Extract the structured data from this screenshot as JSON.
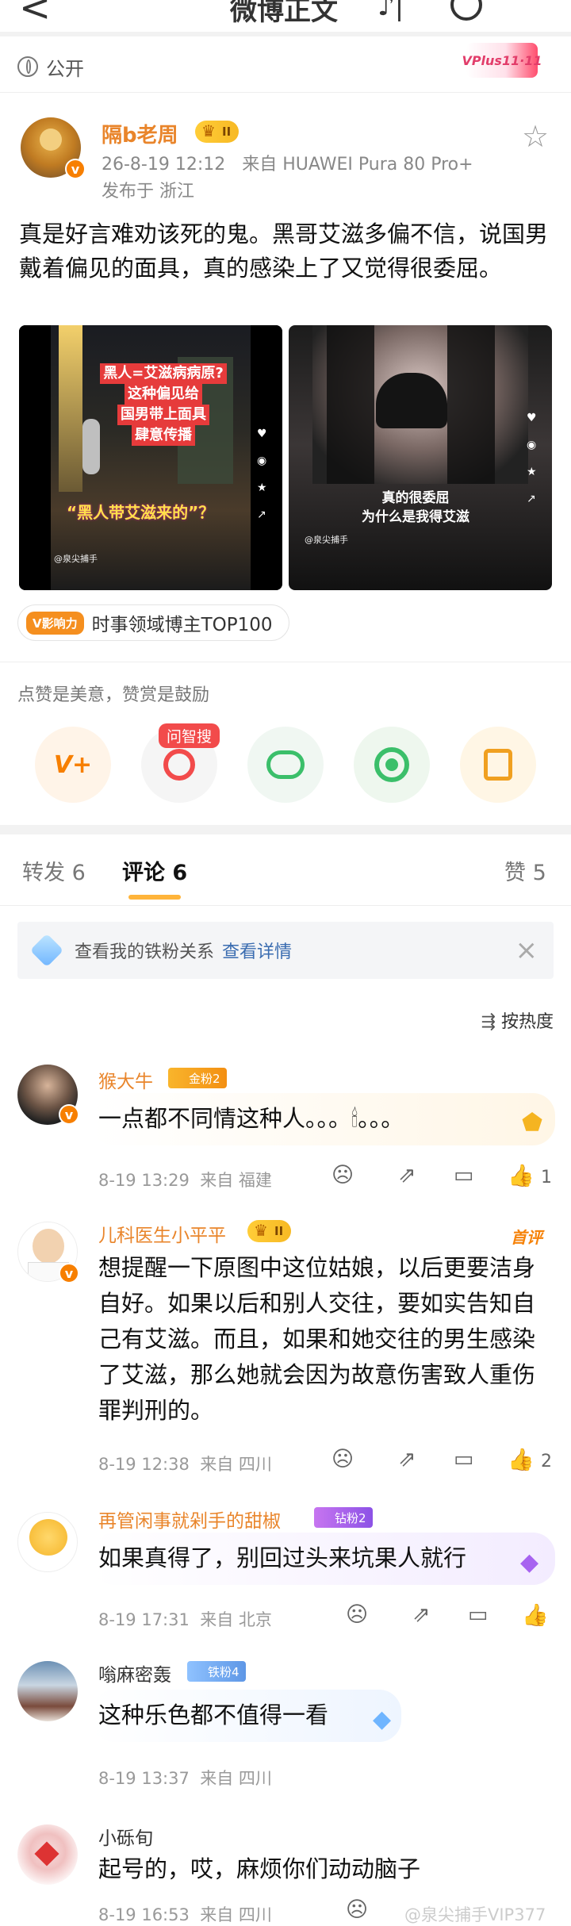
{
  "topbar": {
    "title": "微博正文",
    "back_glyph": "<",
    "mid_glyph": "♪|"
  },
  "visibility": {
    "label": "公开",
    "vplus": "VPlus11·11"
  },
  "post": {
    "author": "隔b老周",
    "level": "II",
    "time": "26-8-19 12:12",
    "source": "来自 HUAWEI Pura 80 Pro+",
    "location": "发布于 浙江",
    "text": "真是好言难劝该死的鬼。黑哥艾滋多偏不信，说国男戴着偏见的面具，真的感染上了又觉得很委屈。",
    "image1": {
      "overlay": [
        "黑人=艾滋病病原?",
        "这种偏见给",
        "国男带上面具",
        "肆意传播"
      ],
      "caption": "“黑人带艾滋来的”？",
      "user": "@泉尖捕手"
    },
    "image2": {
      "overlay": [
        "真的很委屈",
        "为什么是我得艾滋"
      ],
      "user": "@泉尖捕手"
    },
    "tag": {
      "badge": "V影响力",
      "text": "时事领域博主TOP100"
    }
  },
  "reward": {
    "tip": "点赞是美意，赞赏是鼓励",
    "qz_label": "问智搜",
    "actions": [
      {
        "icon": "v-plus-icon",
        "glyph": "V+",
        "color": "#f77f00",
        "bg": "#fff4e8"
      },
      {
        "icon": "zhisou-search-icon",
        "glyph": "◯",
        "color": "#f24b4b",
        "bg": "#f5f5f5"
      },
      {
        "icon": "wechat-icon",
        "glyph": "💬",
        "color": "#3bbf6a",
        "bg": "#f0f7f2"
      },
      {
        "icon": "moments-icon",
        "glyph": "◎",
        "color": "#3bbf6a",
        "bg": "#eef7ee"
      },
      {
        "icon": "save-image-icon",
        "glyph": "▣",
        "color": "#f0a020",
        "bg": "#fff6e5"
      }
    ]
  },
  "tabs": {
    "forward": "转发 6",
    "comment": "评论 6",
    "like": "赞 5"
  },
  "tiebar": {
    "text": "查看我的铁粉关系",
    "link": "查看详情",
    "close": "×"
  },
  "sort": {
    "label": "按热度"
  },
  "comments": [
    {
      "name": "猴大牛",
      "badge": "金粉2",
      "text": "一点都不同情这种人。。。🕯。。。",
      "time": "8-19 13:29",
      "loc": "来自 福建",
      "likes": "1"
    },
    {
      "name": "儿科医生小平平",
      "level": "II",
      "hot": "首评",
      "text": "想提醒一下原图中这位姑娘，以后更要洁身自好。如果以后和别人交往，要如实告知自己有艾滋。而且，如果和她交往的男生感染了艾滋，那么她就会因为故意伤害致人重伤罪判刑的。",
      "time": "8-19 12:38",
      "loc": "来自 四川",
      "likes": "2"
    },
    {
      "name": "再管闲事就剁手的甜椒",
      "badge": "钻粉2",
      "text": "如果真得了，别回过头来坑果人就行",
      "time": "8-19 17:31",
      "loc": "来自 北京",
      "likes": ""
    },
    {
      "name": "嗡麻密轰",
      "badge": "铁粉4",
      "text": "这种乐色都不值得一看",
      "time": "8-19 13:37",
      "loc": "来自 四川",
      "likes": ""
    },
    {
      "name": "小砾旬",
      "text": "起号的，哎，麻烦你们动动脑子",
      "time": "8-19 16:53",
      "loc": "来自 四川",
      "likes": ""
    }
  ],
  "watermark": "@泉尖捕手VIP377"
}
